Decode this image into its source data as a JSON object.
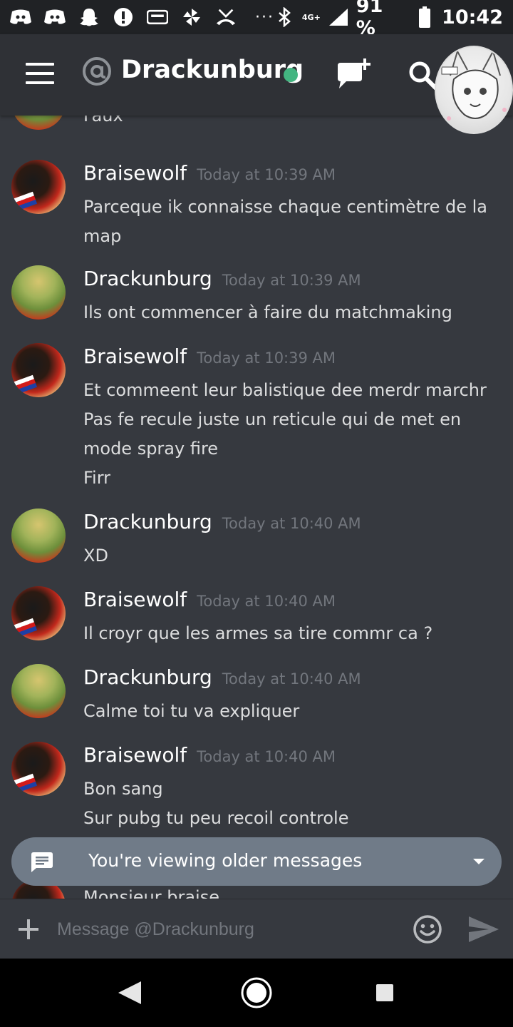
{
  "status_bar": {
    "battery": "91 %",
    "network_badge": "4G+",
    "time": "10:42",
    "icons": [
      "discord-icon",
      "discord-icon",
      "snapchat-icon",
      "alert-icon",
      "screencast-icon",
      "pinwheel-icon",
      "missed-call-icon",
      "more-icon",
      "bluetooth-icon",
      "signal-icon",
      "battery-icon"
    ]
  },
  "header": {
    "channel_name": "Drackunburg",
    "status_color": "#43b581"
  },
  "messages": [
    {
      "author": "",
      "time": "",
      "lines": [
        "Faux"
      ]
    },
    {
      "author": "Braisewolf",
      "time": "Today at 10:39 AM",
      "lines": [
        "Parceque ik connaisse chaque centimètre de la",
        "map"
      ]
    },
    {
      "author": "Drackunburg",
      "time": "Today at 10:39 AM",
      "lines": [
        "Ils ont commencer à faire du matchmaking"
      ]
    },
    {
      "author": "Braisewolf",
      "time": "Today at 10:39 AM",
      "lines": [
        "Et commeent leur balistique dee merdr marchr",
        "Pas fe recule juste un reticule qui de met en",
        "mode spray fire",
        "Firr"
      ]
    },
    {
      "author": "Drackunburg",
      "time": "Today at 10:40 AM",
      "lines": [
        "XD"
      ]
    },
    {
      "author": "Braisewolf",
      "time": "Today at 10:40 AM",
      "lines": [
        "Il croyr que les armes sa tire commr ca ?"
      ]
    },
    {
      "author": "Drackunburg",
      "time": "Today at 10:40 AM",
      "lines": [
        "Calme toi tu va expliquer"
      ]
    },
    {
      "author": "Braisewolf",
      "time": "Today at 10:40 AM",
      "lines": [
        "Bon sang",
        "Sur pubg tu peu recoil controle"
      ]
    },
    {
      "author": "",
      "time": "",
      "lines": [
        "Monsieur braise"
      ]
    }
  ],
  "older_messages_banner": "You're viewing older messages",
  "composer": {
    "placeholder": "Message @Drackunburg"
  },
  "colors": {
    "background": "#36393f",
    "header": "#2f3136",
    "accent_online": "#43b581",
    "timestamp": "#72767d"
  }
}
